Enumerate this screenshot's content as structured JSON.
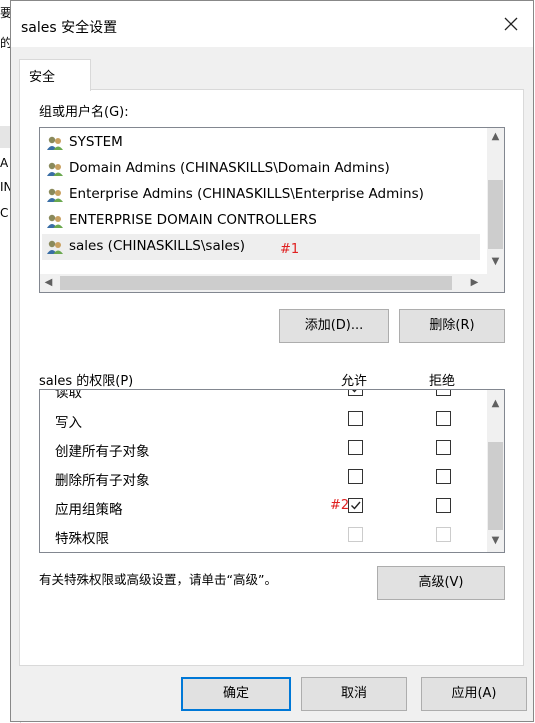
{
  "background_window": {
    "fragments": [
      "要",
      "的",
      "A",
      "IN",
      "C"
    ]
  },
  "dialog": {
    "title": "sales 安全设置",
    "close_icon": "close-icon",
    "tab": "安全"
  },
  "groups": {
    "label": "组或用户名(G):",
    "items": [
      {
        "name": "SYSTEM",
        "icon": "users-icon"
      },
      {
        "name": "Domain Admins (CHINASKILLS\\Domain Admins)",
        "icon": "users-icon"
      },
      {
        "name": "Enterprise Admins (CHINASKILLS\\Enterprise Admins)",
        "icon": "users-icon"
      },
      {
        "name": "ENTERPRISE DOMAIN CONTROLLERS",
        "icon": "users-icon"
      },
      {
        "name": "sales (CHINASKILLS\\sales)",
        "icon": "users-icon",
        "selected": true
      }
    ],
    "annotation": "#1",
    "annotation_color": "#e02020"
  },
  "group_buttons": {
    "add": "添加(D)...",
    "remove": "删除(R)"
  },
  "permissions": {
    "label": "sales 的权限(P)",
    "col_allow": "允许",
    "col_deny": "拒绝",
    "rows": [
      {
        "name": "读取",
        "allow": true,
        "deny": false,
        "partial": true
      },
      {
        "name": "写入",
        "allow": false,
        "deny": false
      },
      {
        "name": "创建所有子对象",
        "allow": false,
        "deny": false
      },
      {
        "name": "删除所有子对象",
        "allow": false,
        "deny": false
      },
      {
        "name": "应用组策略",
        "allow": true,
        "deny": false
      },
      {
        "name": "特殊权限",
        "allow": false,
        "deny": false,
        "disabled": true
      }
    ],
    "annotation": "#2"
  },
  "advanced": {
    "hint": "有关特殊权限或高级设置，请单击“高级”。",
    "button": "高级(V)"
  },
  "footer": {
    "ok": "确定",
    "cancel": "取消",
    "apply": "应用(A)"
  },
  "colors": {
    "accent": "#0078d7",
    "annotation": "#e02020"
  }
}
